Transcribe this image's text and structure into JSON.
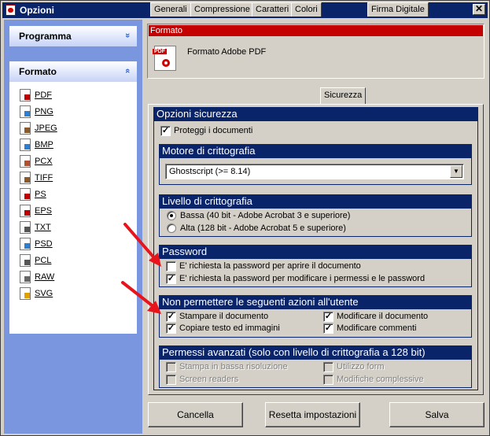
{
  "window": {
    "title": "Opzioni",
    "close_glyph": "✕"
  },
  "sidebar": {
    "programma": {
      "title": "Programma",
      "chevron": "»"
    },
    "formato": {
      "title": "Formato",
      "chevron": "«",
      "items": [
        {
          "label": "PDF",
          "color": "#c00000"
        },
        {
          "label": "PNG",
          "color": "#2a7fd4"
        },
        {
          "label": "JPEG",
          "color": "#8b5a2b"
        },
        {
          "label": "BMP",
          "color": "#2a7fd4"
        },
        {
          "label": "PCX",
          "color": "#b05030"
        },
        {
          "label": "TIFF",
          "color": "#8b5a2b"
        },
        {
          "label": "PS",
          "color": "#c00000"
        },
        {
          "label": "EPS",
          "color": "#c00000"
        },
        {
          "label": "TXT",
          "color": "#555555"
        },
        {
          "label": "PSD",
          "color": "#2a7fd4"
        },
        {
          "label": "PCL",
          "color": "#555555"
        },
        {
          "label": "RAW",
          "color": "#666666"
        },
        {
          "label": "SVG",
          "color": "#e0a000"
        }
      ]
    }
  },
  "header": {
    "bar_title": "Formato",
    "format_name": "Formato Adobe PDF",
    "icon_tag": "PDF"
  },
  "tabs": [
    {
      "label": "Generali"
    },
    {
      "label": "Compressione"
    },
    {
      "label": "Caratteri"
    },
    {
      "label": "Colori"
    },
    {
      "label": "Sicurezza",
      "active": true
    },
    {
      "label": "Firma Digitale"
    }
  ],
  "security": {
    "title": "Opzioni sicurezza",
    "protect": {
      "label": "Proteggi i documenti",
      "checked": true
    },
    "engine": {
      "title": "Motore di crittografia",
      "value": "Ghostscript (>= 8.14)"
    },
    "level": {
      "title": "Livello di crittografia",
      "options": [
        {
          "label": "Bassa (40 bit - Adobe Acrobat 3 e superiore)",
          "selected": true
        },
        {
          "label": "Alta (128 bit - Adobe Acrobat 5 e superiore)",
          "selected": false
        }
      ]
    },
    "password": {
      "title": "Password",
      "open": {
        "label": "E' richiesta la password per aprire il documento",
        "checked": false
      },
      "modify": {
        "label": "E' richiesta la password per modificare i permessi e le password",
        "checked": true
      }
    },
    "deny": {
      "title": "Non permettere le seguenti azioni all'utente",
      "print": {
        "label": "Stampare il documento",
        "checked": true
      },
      "copy": {
        "label": "Copiare testo ed immagini",
        "checked": true
      },
      "modify_doc": {
        "label": "Modificare il documento",
        "checked": true
      },
      "modify_comments": {
        "label": "Modificare commenti",
        "checked": true
      }
    },
    "advanced": {
      "title": "Permessi avanzati (solo con livello di crittografia a 128 bit)",
      "low_res": {
        "label": "Stampa in bassa risoluzione",
        "checked": false
      },
      "screen": {
        "label": "Screen readers",
        "checked": false
      },
      "form": {
        "label": "Utilizzo form",
        "checked": false
      },
      "complex": {
        "label": "Modifiche complessive",
        "checked": false
      }
    }
  },
  "buttons": {
    "cancel": "Cancella",
    "reset": "Resetta impostazioni",
    "save": "Salva"
  },
  "check_glyph": "✓",
  "colors": {
    "title_bar": "#0a246a",
    "section_head": "#0a246a",
    "format_bar": "#c40000",
    "annotation_arrow": "#e8141c"
  }
}
